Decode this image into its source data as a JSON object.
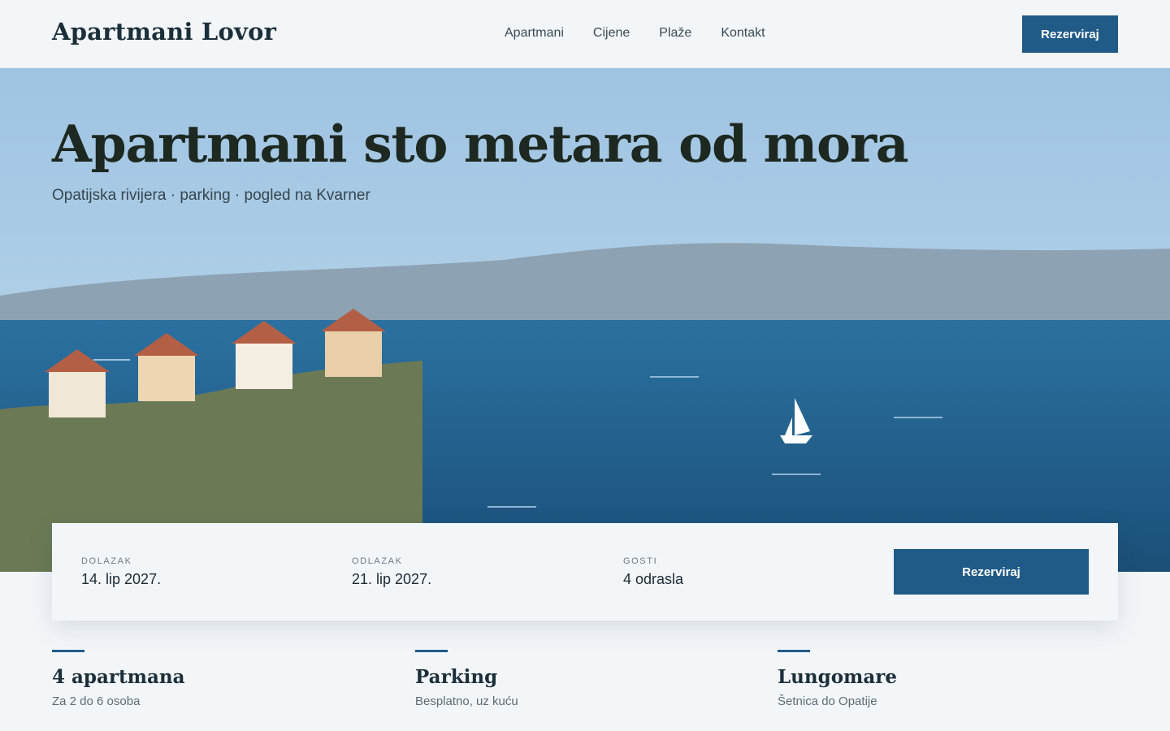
{
  "header": {
    "brand": "Apartmani Lovor",
    "nav": [
      {
        "label": "Apartmani"
      },
      {
        "label": "Cijene"
      },
      {
        "label": "Plaže"
      },
      {
        "label": "Kontakt"
      }
    ],
    "cta_label": "Rezerviraj"
  },
  "hero": {
    "title": "Apartmani sto metara od mora",
    "subtitle": "Opatijska rivijera · parking · pogled na Kvarner"
  },
  "booking": {
    "arrival": {
      "label": "DOLAZAK",
      "value": "14. lip 2027."
    },
    "departure": {
      "label": "ODLAZAK",
      "value": "21. lip 2027."
    },
    "guests": {
      "label": "GOSTI",
      "value": "4 odrasla"
    },
    "cta_label": "Rezerviraj"
  },
  "features": [
    {
      "title": "4 apartmana",
      "description": "Za 2 do 6 osoba"
    },
    {
      "title": "Parking",
      "description": "Besplatno, uz kuću"
    },
    {
      "title": "Lungomare",
      "description": "Šetnica do Opatije"
    }
  ],
  "colors": {
    "accent": "#205b88",
    "sea": "#2a6c9c",
    "land": "#6b7a55",
    "roof": "#b35f45"
  }
}
